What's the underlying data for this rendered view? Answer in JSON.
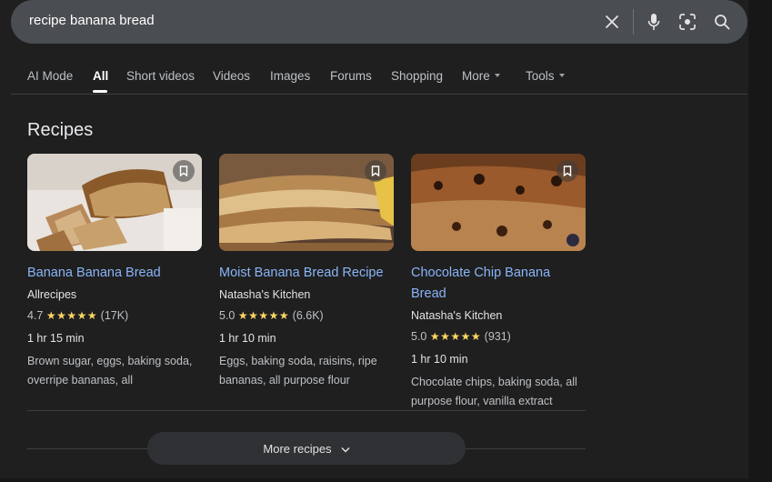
{
  "search": {
    "query": "recipe banana bread"
  },
  "tabs": [
    {
      "label": "AI Mode"
    },
    {
      "label": "All"
    },
    {
      "label": "Short videos"
    },
    {
      "label": "Videos"
    },
    {
      "label": "Images"
    },
    {
      "label": "Forums"
    },
    {
      "label": "Shopping"
    },
    {
      "label": "More"
    },
    {
      "label": "Tools"
    }
  ],
  "recipes": {
    "title": "Recipes",
    "items": [
      {
        "title": "Banana Banana Bread",
        "source": "Allrecipes",
        "rating": "4.7",
        "stars": "★★★★★",
        "reviews": "(17K)",
        "time": "1 hr 15 min",
        "ingredients": "Brown sugar, eggs, baking soda, overripe bananas, all"
      },
      {
        "title": "Moist Banana Bread Recipe",
        "source": "Natasha's Kitchen",
        "rating": "5.0",
        "stars": "★★★★★",
        "reviews": "(6.6K)",
        "time": "1 hr 10 min",
        "ingredients": "Eggs, baking soda, raisins, ripe bananas, all purpose flour"
      },
      {
        "title": "Chocolate Chip Banana Bread",
        "source": "Natasha's Kitchen",
        "rating": "5.0",
        "stars": "★★★★★",
        "reviews": "(931)",
        "time": "1 hr 10 min",
        "ingredients": "Chocolate chips, baking soda, all purpose flour, vanilla extract"
      }
    ],
    "more_label": "More recipes"
  },
  "colors": {
    "background": "#1f1f1f",
    "search_bar": "#4a4d51",
    "link": "#8ab4f8",
    "stars": "#fdd663"
  }
}
